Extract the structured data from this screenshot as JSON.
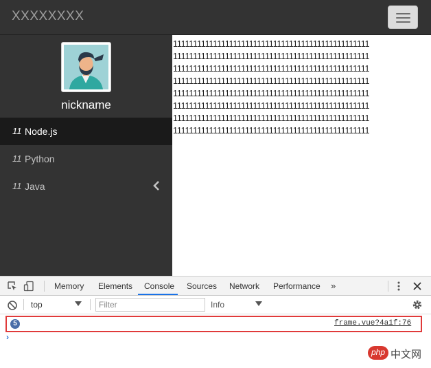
{
  "navbar": {
    "brand": "XXXXXXXX"
  },
  "sidebar": {
    "nickname": "nickname",
    "items": [
      {
        "num": "11",
        "label": "Node.js",
        "active": true
      },
      {
        "num": "11",
        "label": "Python",
        "active": false
      },
      {
        "num": "11",
        "label": "Java",
        "active": false,
        "has_chevron": true
      }
    ]
  },
  "content": {
    "lines": [
      "1111111111111111111111111111111111111111111111111",
      "1111111111111111111111111111111111111111111111111",
      "1111111111111111111111111111111111111111111111111",
      "1111111111111111111111111111111111111111111111111",
      "1111111111111111111111111111111111111111111111111",
      "1111111111111111111111111111111111111111111111111",
      "1111111111111111111111111111111111111111111111111",
      "1111111111111111111111111111111111111111111111111"
    ]
  },
  "devtools": {
    "tabs": [
      "Memory",
      "Elements",
      "Console",
      "Sources",
      "Network",
      "Performance"
    ],
    "active_tab": "Console",
    "more": "»",
    "context": "top",
    "filter_placeholder": "Filter",
    "level": "Info",
    "log": {
      "count": "5",
      "source": "frame.vue?4a1f:76"
    },
    "prompt": "›",
    "accent": "#1a73e8",
    "highlight_color": "#e03a3a"
  },
  "watermark": {
    "logo": "php",
    "text": "中文网"
  }
}
